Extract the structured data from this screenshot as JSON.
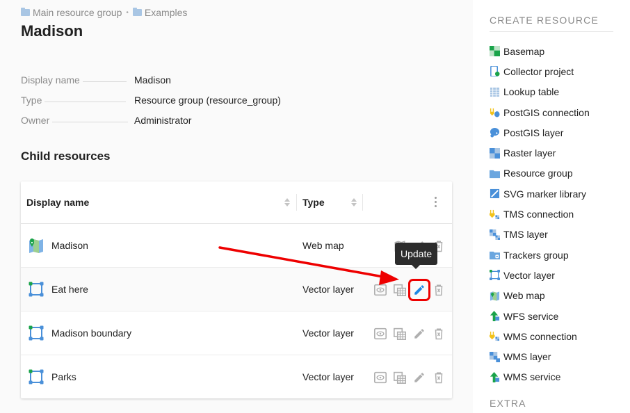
{
  "breadcrumb": [
    {
      "label": "Main resource group"
    },
    {
      "label": "Examples"
    }
  ],
  "page_title": "Madison",
  "properties": [
    {
      "key": "Display name",
      "value": "Madison"
    },
    {
      "key": "Type",
      "value": "Resource group (resource_group)"
    },
    {
      "key": "Owner",
      "value": "Administrator"
    }
  ],
  "child_resources": {
    "title": "Child resources",
    "columns": {
      "name": "Display name",
      "type": "Type"
    },
    "rows": [
      {
        "name": "Madison",
        "type": "Web map",
        "icon": "web-map-icon"
      },
      {
        "name": "Eat here",
        "type": "Vector layer",
        "icon": "vector-layer-icon"
      },
      {
        "name": "Madison boundary",
        "type": "Vector layer",
        "icon": "vector-layer-icon"
      },
      {
        "name": "Parks",
        "type": "Vector layer",
        "icon": "vector-layer-icon"
      }
    ]
  },
  "tooltip": "Update",
  "sidebar": {
    "title": "CREATE RESOURCE",
    "items": [
      {
        "label": "Basemap",
        "icon": "basemap-icon"
      },
      {
        "label": "Collector project",
        "icon": "collector-project-icon"
      },
      {
        "label": "Lookup table",
        "icon": "lookup-table-icon"
      },
      {
        "label": "PostGIS connection",
        "icon": "postgis-connection-icon"
      },
      {
        "label": "PostGIS layer",
        "icon": "postgis-layer-icon"
      },
      {
        "label": "Raster layer",
        "icon": "raster-layer-icon"
      },
      {
        "label": "Resource group",
        "icon": "resource-group-icon"
      },
      {
        "label": "SVG marker library",
        "icon": "svg-marker-library-icon"
      },
      {
        "label": "TMS connection",
        "icon": "tms-connection-icon"
      },
      {
        "label": "TMS layer",
        "icon": "tms-layer-icon"
      },
      {
        "label": "Trackers group",
        "icon": "trackers-group-icon"
      },
      {
        "label": "Vector layer",
        "icon": "vector-layer-icon"
      },
      {
        "label": "Web map",
        "icon": "web-map-icon"
      },
      {
        "label": "WFS service",
        "icon": "wfs-service-icon"
      },
      {
        "label": "WMS connection",
        "icon": "wms-connection-icon"
      },
      {
        "label": "WMS layer",
        "icon": "wms-layer-icon"
      },
      {
        "label": "WMS service",
        "icon": "wms-service-icon"
      }
    ],
    "extra_title": "EXTRA"
  },
  "colors": {
    "accent": "#1e88e5",
    "highlight_red": "#ee0000",
    "icon_green": "#1aa34a",
    "icon_blue": "#4a90d9"
  }
}
